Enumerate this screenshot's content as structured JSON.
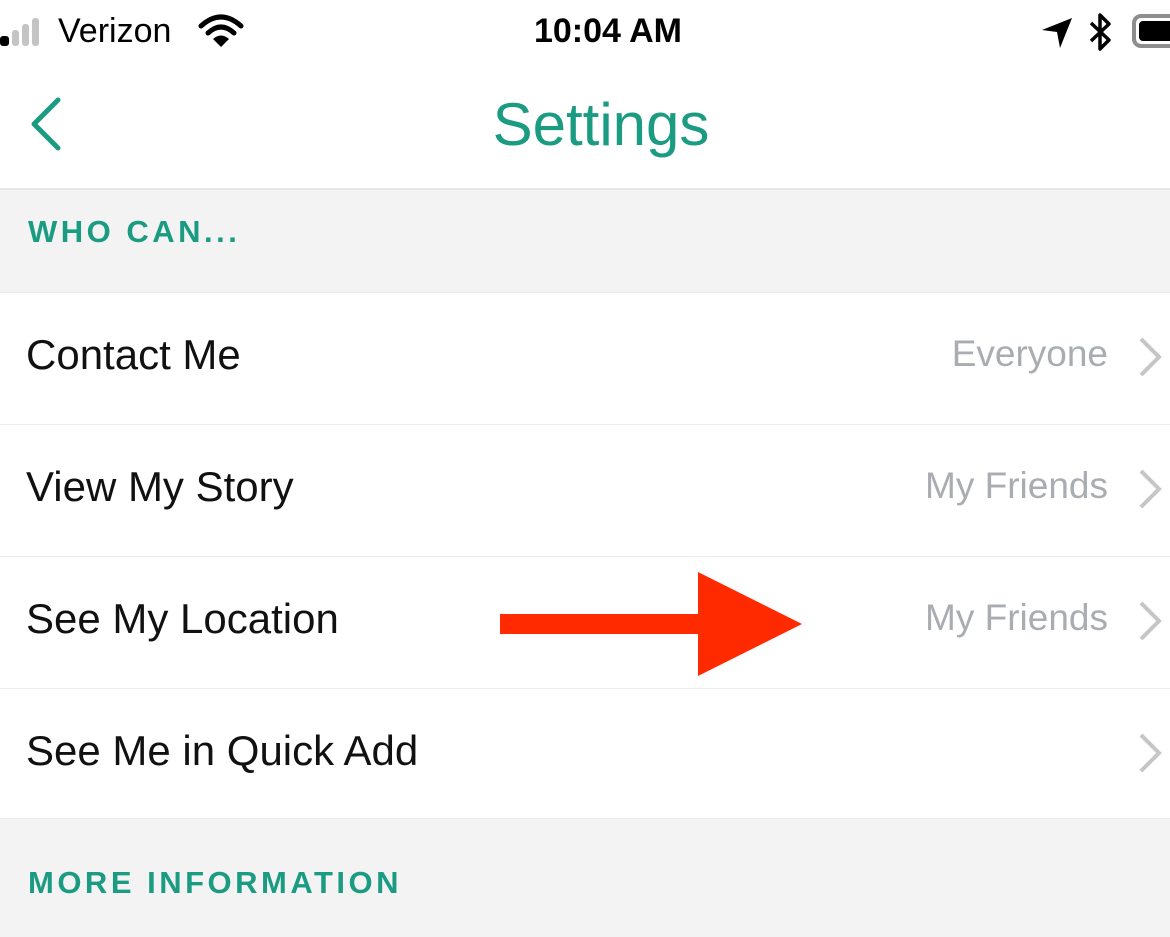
{
  "status_bar": {
    "carrier": "Verizon",
    "time": "10:04 AM",
    "signal_bars_filled": 1,
    "signal_bars_total": 4,
    "icons": [
      "signal-icon",
      "wifi-icon",
      "location-arrow-icon",
      "bluetooth-icon",
      "battery-icon"
    ],
    "battery_level": 1.0
  },
  "nav": {
    "back_icon": "chevron-left-icon",
    "title": "Settings"
  },
  "sections": [
    {
      "header": "WHO CAN...",
      "rows": [
        {
          "label": "Contact Me",
          "value": "Everyone"
        },
        {
          "label": "View My Story",
          "value": "My Friends"
        },
        {
          "label": "See My Location",
          "value": "My Friends"
        },
        {
          "label": "See Me in Quick Add",
          "value": ""
        }
      ]
    },
    {
      "header": "MORE INFORMATION",
      "rows": []
    }
  ],
  "annotation": {
    "type": "red-arrow",
    "points_to": "See My Location value",
    "color": "#ff2a00"
  },
  "colors": {
    "accent": "#1b9c82",
    "value_text": "#a9adb1",
    "section_bg": "#f3f3f3"
  }
}
